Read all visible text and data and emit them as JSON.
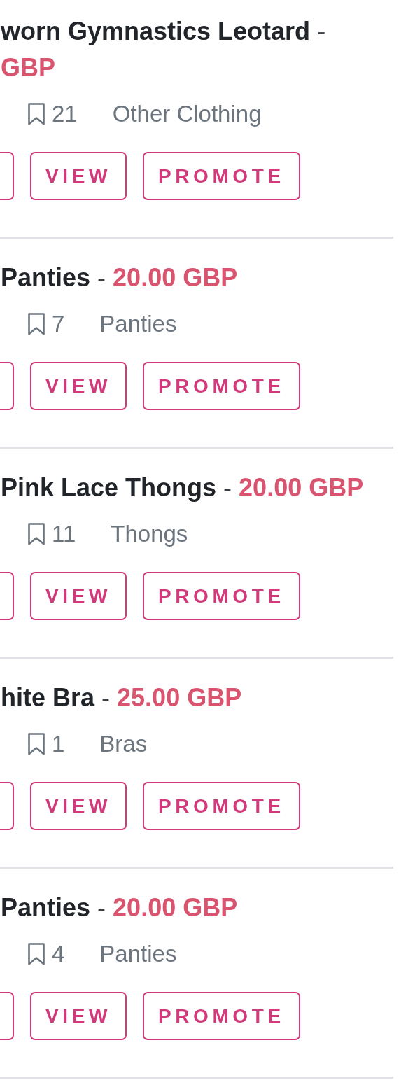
{
  "listings": [
    {
      "title": "worn Gymnastics Leotard",
      "separator": "-",
      "price": "GBP",
      "saves": "21",
      "category": "Other Clothing",
      "actions": [
        {
          "kind": "clipped"
        },
        {
          "kind": "outline",
          "label": "VIEW"
        },
        {
          "kind": "outline",
          "label": "PROMOTE"
        }
      ]
    },
    {
      "title": "Panties",
      "separator": "-",
      "price": "20.00 GBP",
      "saves": "7",
      "category": "Panties",
      "actions": [
        {
          "kind": "clipped"
        },
        {
          "kind": "outline",
          "label": "VIEW"
        },
        {
          "kind": "outline",
          "label": "PROMOTE"
        }
      ]
    },
    {
      "title": "Pink Lace Thongs",
      "separator": "-",
      "price": "20.00 GBP",
      "saves": "11",
      "category": "Thongs",
      "actions": [
        {
          "kind": "clipped"
        },
        {
          "kind": "outline",
          "label": "VIEW"
        },
        {
          "kind": "outline",
          "label": "PROMOTE"
        }
      ]
    },
    {
      "title": "hite Bra",
      "separator": "-",
      "price": "25.00 GBP",
      "saves": "1",
      "category": "Bras",
      "actions": [
        {
          "kind": "clipped"
        },
        {
          "kind": "outline",
          "label": "VIEW"
        },
        {
          "kind": "outline",
          "label": "PROMOTE"
        }
      ]
    },
    {
      "title": "Panties",
      "separator": "-",
      "price": "20.00 GBP",
      "saves": "4",
      "category": "Panties",
      "actions": [
        {
          "kind": "clipped"
        },
        {
          "kind": "outline",
          "label": "VIEW"
        },
        {
          "kind": "outline",
          "label": "PROMOTE"
        }
      ]
    }
  ]
}
